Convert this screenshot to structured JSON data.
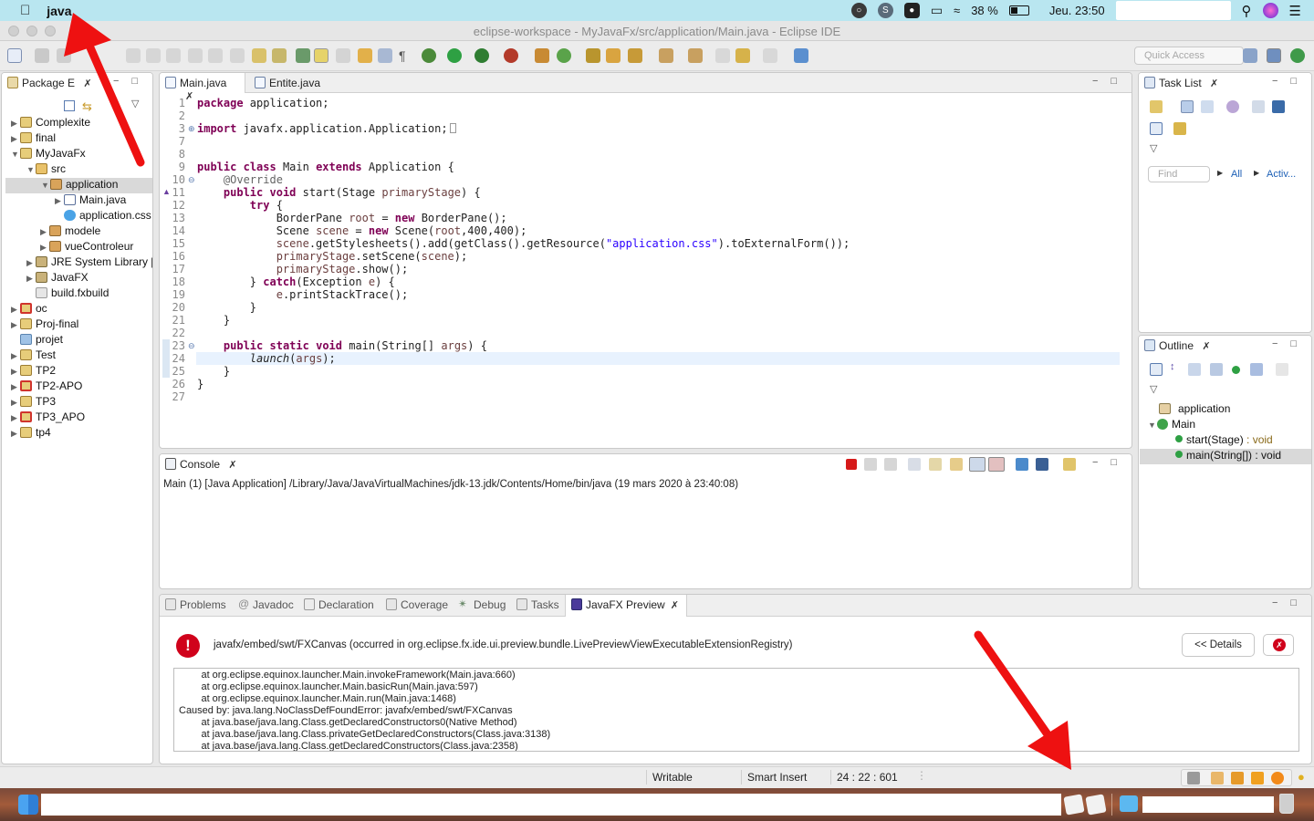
{
  "menubar": {
    "app_name": "java",
    "battery": "38 %",
    "datetime": "Jeu. 23:50"
  },
  "window": {
    "title": "eclipse-workspace - MyJavaFx/src/application/Main.java - Eclipse IDE"
  },
  "toolbar": {
    "quick_access_placeholder": "Quick Access"
  },
  "package_explorer": {
    "tab_label": "Package E",
    "items": [
      {
        "label": "Complexite"
      },
      {
        "label": "final"
      },
      {
        "label": "MyJavaFx"
      },
      {
        "label": "src"
      },
      {
        "label": "application"
      },
      {
        "label": "Main.java"
      },
      {
        "label": "application.css"
      },
      {
        "label": "modele"
      },
      {
        "label": "vueControleur"
      },
      {
        "label": "JRE System Library ["
      },
      {
        "label": "JavaFX"
      },
      {
        "label": "build.fxbuild"
      },
      {
        "label": "oc"
      },
      {
        "label": "Proj-final"
      },
      {
        "label": "projet"
      },
      {
        "label": "Test"
      },
      {
        "label": "TP2"
      },
      {
        "label": "TP2-APO"
      },
      {
        "label": "TP3"
      },
      {
        "label": "TP3_APO"
      },
      {
        "label": "tp4"
      }
    ]
  },
  "editor": {
    "tabs": [
      {
        "label": "Main.java"
      },
      {
        "label": "Entite.java"
      }
    ],
    "line_numbers": [
      "1",
      "2",
      "3",
      "7",
      "8",
      "9",
      "10",
      "11",
      "12",
      "13",
      "14",
      "15",
      "16",
      "17",
      "18",
      "19",
      "20",
      "21",
      "22",
      "23",
      "24",
      "25",
      "26",
      "27"
    ],
    "code": {
      "l1_kw": "package",
      "l1_rest": " application;",
      "l3_kw": "import",
      "l3_rest": " javafx.application.Application;",
      "l9_kw1": "public",
      "l9_kw2": "class",
      "l9_mid": " Main ",
      "l9_kw3": "extends",
      "l9_rest": " Application {",
      "l10": "    @Override",
      "l11_kw1": "public",
      "l11_kw2": "void",
      "l11_rest": " start(Stage ",
      "l11_var": "primaryStage",
      "l11_end": ") {",
      "l12_kw": "try",
      "l12_rest": " {",
      "l13_a": "BorderPane ",
      "l13_var": "root",
      "l13_b": " = ",
      "l13_kw": "new",
      "l13_c": " BorderPane();",
      "l14_a": "Scene ",
      "l14_var": "scene",
      "l14_b": " = ",
      "l14_kw": "new",
      "l14_c": " Scene(",
      "l14_var2": "root",
      "l14_d": ",400,400);",
      "l15_var": "scene",
      "l15_a": ".getStylesheets().add(getClass().getResource(",
      "l15_str": "\"application.css\"",
      "l15_b": ").toExternalForm());",
      "l16_var": "primaryStage",
      "l16_a": ".setScene(",
      "l16_var2": "scene",
      "l16_b": ");",
      "l17_var": "primaryStage",
      "l17_a": ".show();",
      "l18_a": "} ",
      "l18_kw": "catch",
      "l18_b": "(Exception ",
      "l18_var": "e",
      "l18_c": ") {",
      "l19_var": "e",
      "l19_a": ".printStackTrace();",
      "l20": "}",
      "l21": "}",
      "l23_kw1": "public",
      "l23_kw2": "static",
      "l23_kw3": "void",
      "l23_a": " main(String[] ",
      "l23_var": "args",
      "l23_b": ") {",
      "l24_it": "launch",
      "l24_a": "(",
      "l24_var": "args",
      "l24_b": ");",
      "l25": "}",
      "l26": "}"
    }
  },
  "task_list": {
    "tab_label": "Task List",
    "find_placeholder": "Find",
    "all_label": "All",
    "activate_label": "Activ..."
  },
  "outline": {
    "tab_label": "Outline",
    "items": [
      {
        "label": "application"
      },
      {
        "label": "Main"
      },
      {
        "label": "start(Stage)",
        "type": " : void"
      },
      {
        "label": "main(String[])",
        "type": " : void"
      }
    ]
  },
  "console": {
    "tab_label": "Console",
    "launch_info": "Main (1) [Java Application] /Library/Java/JavaVirtualMachines/jdk-13.jdk/Contents/Home/bin/java (19 mars 2020 à 23:40:08)"
  },
  "bottom_panel": {
    "tabs": [
      {
        "label": "Problems"
      },
      {
        "label": "Javadoc"
      },
      {
        "label": "Declaration"
      },
      {
        "label": "Coverage"
      },
      {
        "label": "Debug"
      },
      {
        "label": "Tasks"
      },
      {
        "label": "JavaFX Preview"
      }
    ],
    "error_message": "javafx/embed/swt/FXCanvas (occurred in org.eclipse.fx.ide.ui.preview.bundle.LivePreviewViewExecutableExtensionRegistry)",
    "details_button": "<< Details",
    "stack_trace": [
      "        at org.eclipse.equinox.launcher.Main.invokeFramework(Main.java:660)",
      "        at org.eclipse.equinox.launcher.Main.basicRun(Main.java:597)",
      "        at org.eclipse.equinox.launcher.Main.run(Main.java:1468)",
      "Caused by: java.lang.NoClassDefFoundError: javafx/embed/swt/FXCanvas",
      "        at java.base/java.lang.Class.getDeclaredConstructors0(Native Method)",
      "        at java.base/java.lang.Class.privateGetDeclaredConstructors(Class.java:3138)",
      "        at java.base/java.lang.Class.getDeclaredConstructors(Class.java:2358)"
    ]
  },
  "statusbar": {
    "writable": "Writable",
    "insert_mode": "Smart Insert",
    "position": "24 : 22 : 601"
  },
  "colors": {
    "menubar_bg": "#b9e6f0",
    "annotation_arrow": "#ee1111",
    "keyword": "#7f0055",
    "string": "#2a00ff",
    "error_red": "#d0021b"
  }
}
